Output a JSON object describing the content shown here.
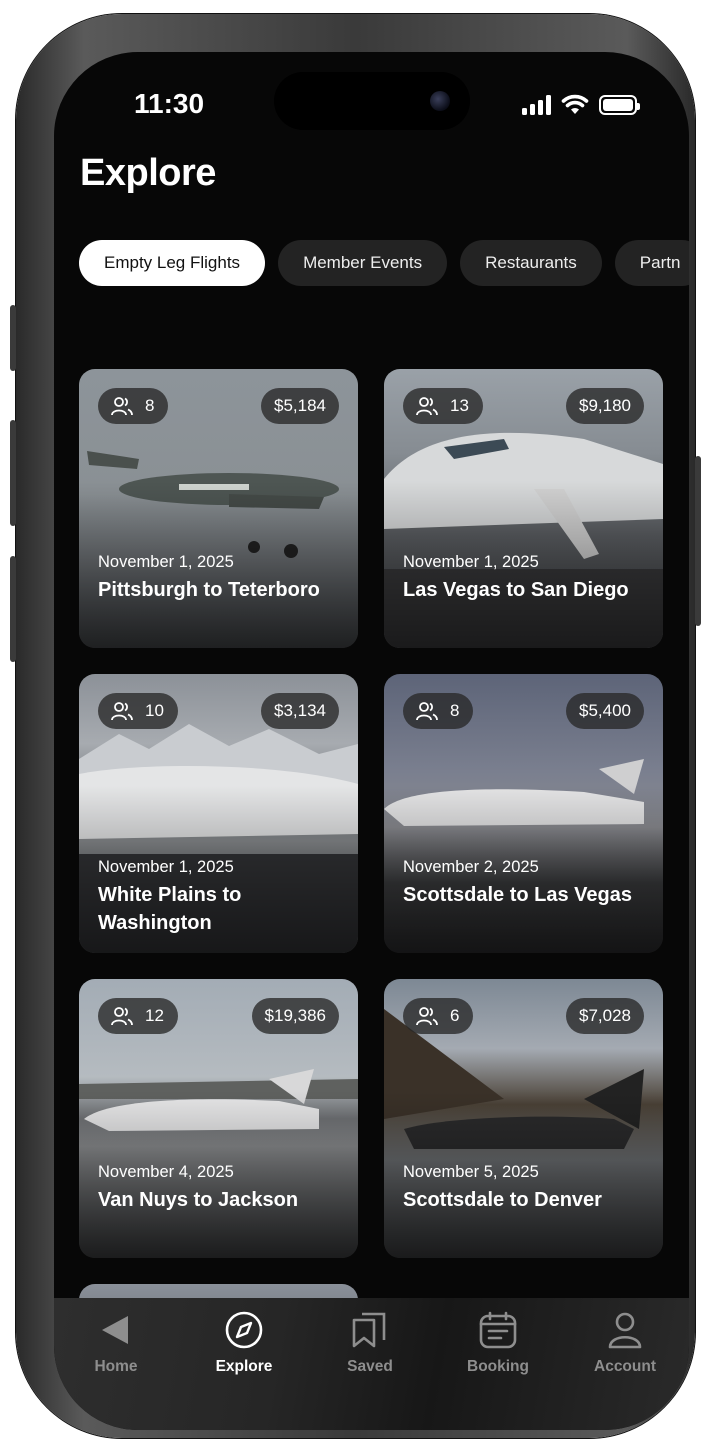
{
  "status_bar": {
    "time": "11:30"
  },
  "page": {
    "title": "Explore"
  },
  "tabs": [
    {
      "label": "Empty Leg Flights",
      "active": true
    },
    {
      "label": "Member Events"
    },
    {
      "label": "Restaurants"
    },
    {
      "label": "Partn"
    }
  ],
  "flights": [
    {
      "passengers": "8",
      "price": "$5,184",
      "date": "November 1, 2025",
      "route": "Pittsburgh to Teterboro"
    },
    {
      "passengers": "13",
      "price": "$9,180",
      "date": "November 1, 2025",
      "route": "Las Vegas to San Diego"
    },
    {
      "passengers": "10",
      "price": "$3,134",
      "date": "November 1, 2025",
      "route": "White Plains to Washington"
    },
    {
      "passengers": "8",
      "price": "$5,400",
      "date": "November 2, 2025",
      "route": "Scottsdale to Las Vegas"
    },
    {
      "passengers": "12",
      "price": "$19,386",
      "date": "November 4, 2025",
      "route": "Van Nuys to Jackson"
    },
    {
      "passengers": "6",
      "price": "$7,028",
      "date": "November 5, 2025",
      "route": "Scottsdale to Denver"
    }
  ],
  "nav": [
    {
      "label": "Home",
      "icon": "home-triangle-icon"
    },
    {
      "label": "Explore",
      "icon": "compass-icon",
      "active": true
    },
    {
      "label": "Saved",
      "icon": "bookmarks-icon"
    },
    {
      "label": "Booking",
      "icon": "calendar-icon"
    },
    {
      "label": "Account",
      "icon": "person-icon"
    }
  ],
  "colors": {
    "background": "#070707",
    "tab_active": "#ffffff",
    "tab_inactive": "#232323"
  }
}
